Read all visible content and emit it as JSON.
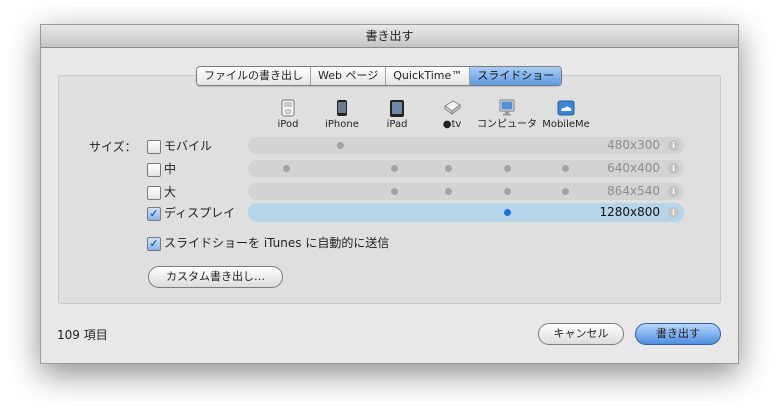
{
  "window": {
    "title": "書き出す"
  },
  "tabs": [
    {
      "label": "ファイルの書き出し",
      "active": false
    },
    {
      "label": "Web ページ",
      "active": false
    },
    {
      "label": "QuickTime™",
      "active": false
    },
    {
      "label": "スライドショー",
      "active": true
    }
  ],
  "devices": [
    {
      "label": "iPod",
      "icon": "ipod-icon"
    },
    {
      "label": "iPhone",
      "icon": "iphone-icon"
    },
    {
      "label": "iPad",
      "icon": "ipad-icon"
    },
    {
      "label": "tv",
      "icon": "apple-tv-icon"
    },
    {
      "label": "コンピュータ",
      "icon": "computer-icon"
    },
    {
      "label": "MobileMe",
      "icon": "mobileme-icon"
    }
  ],
  "size_label": "サイズ：",
  "sizes": [
    {
      "label": "モバイル",
      "resolution": "480x300",
      "checked": false,
      "selected": false,
      "supported": [
        "iPhone"
      ]
    },
    {
      "label": "中",
      "resolution": "640x400",
      "checked": false,
      "selected": false,
      "supported": [
        "iPod",
        "iPad",
        "tv",
        "コンピュータ",
        "MobileMe"
      ]
    },
    {
      "label": "大",
      "resolution": "864x540",
      "checked": false,
      "selected": false,
      "supported": [
        "iPad",
        "tv",
        "コンピュータ",
        "MobileMe"
      ]
    },
    {
      "label": "ディスプレイ",
      "resolution": "1280x800",
      "checked": true,
      "selected": true,
      "supported": [
        "コンピュータ"
      ]
    }
  ],
  "send_to_itunes": {
    "label": "スライドショーを iTunes に自動的に送信",
    "checked": true
  },
  "custom_export_button": "カスタム書き出し…",
  "item_count": "109 項目",
  "cancel_button": "キャンセル",
  "export_button": "書き出す",
  "colors": {
    "accent": "#5f9be0",
    "selected_row": "#b7d5ea",
    "dot": "#a3a3a3",
    "dot_selected": "#1f6fd6"
  }
}
